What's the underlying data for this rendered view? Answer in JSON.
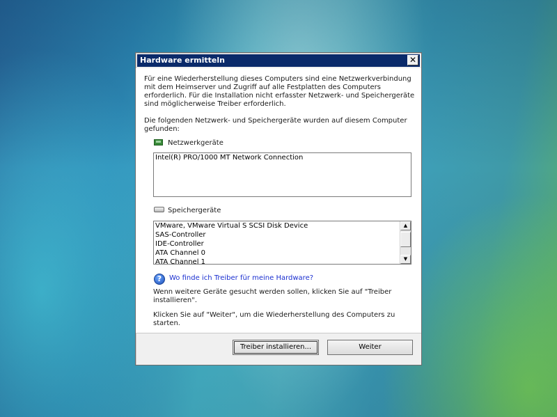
{
  "dialog": {
    "title": "Hardware ermitteln",
    "close_glyph": "✕",
    "intro": "Für eine Wiederherstellung dieses Computers sind eine Netzwerkverbindung mit dem Heimserver und Zugriff auf alle Festplatten des Computers erforderlich. Für die Installation nicht erfasster Netzwerk- und Speichergeräte sind möglicherweise Treiber erforderlich.",
    "found_text": "Die folgenden Netzwerk- und Speichergeräte wurden auf diesem Computer gefunden:",
    "network": {
      "label": "Netzwerkgeräte",
      "items": [
        "Intel(R) PRO/1000 MT Network Connection"
      ]
    },
    "storage": {
      "label": "Speichergeräte",
      "items": [
        "VMware, VMware Virtual S SCSI Disk Device",
        "SAS-Controller",
        "IDE-Controller",
        "ATA Channel 0",
        "ATA Channel 1"
      ]
    },
    "help_link": "Wo finde ich Treiber für meine Hardware?",
    "more_devices_text": "Wenn weitere Geräte gesucht werden sollen, klicken Sie auf \"Treiber installieren\".",
    "continue_text": "Klicken Sie auf \"Weiter\", um die Wiederherstellung des Computers zu starten.",
    "buttons": {
      "install": "Treiber installieren...",
      "next": "Weiter"
    }
  }
}
